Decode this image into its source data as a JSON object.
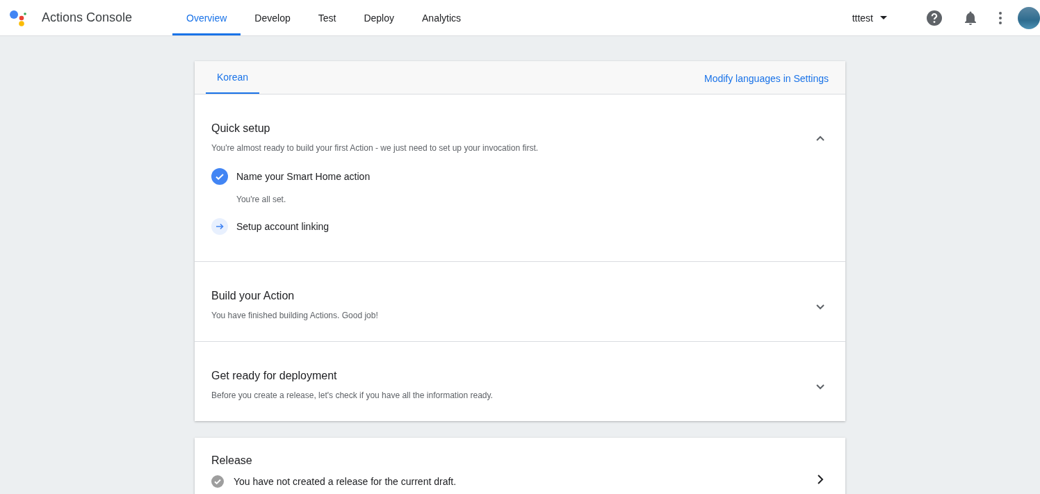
{
  "app": {
    "title": "Actions Console"
  },
  "nav": [
    {
      "label": "Overview",
      "selected": true
    },
    {
      "label": "Develop",
      "selected": false
    },
    {
      "label": "Test",
      "selected": false
    },
    {
      "label": "Deploy",
      "selected": false
    },
    {
      "label": "Analytics",
      "selected": false
    }
  ],
  "project": {
    "name": "tttest"
  },
  "language_tabs": [
    {
      "label": "Korean",
      "selected": true
    }
  ],
  "settings_link": "Modify languages in Settings",
  "sections": [
    {
      "title": "Quick setup",
      "description": "You're almost ready to build your first Action - we just need to set up your invocation first.",
      "expanded": true,
      "steps": [
        {
          "label": "Name your Smart Home action",
          "done": true,
          "note": "You're all set."
        },
        {
          "label": "Setup account linking",
          "done": false
        }
      ]
    },
    {
      "title": "Build your Action",
      "description": "You have finished building Actions. Good job!",
      "expanded": false
    },
    {
      "title": "Get ready for deployment",
      "description": "Before you create a release, let's check if you have all the information ready.",
      "expanded": false
    }
  ],
  "release": {
    "title": "Release",
    "status": "You have not created a release for the current draft."
  }
}
